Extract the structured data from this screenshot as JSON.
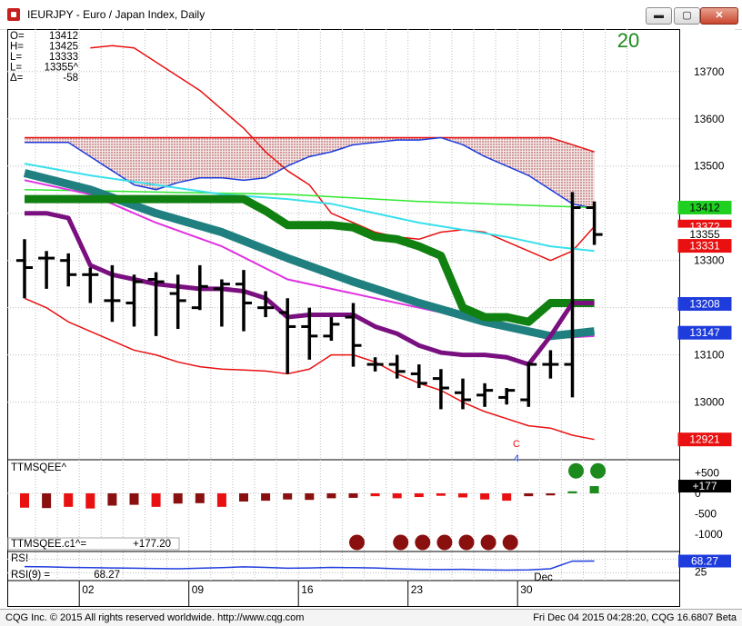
{
  "window": {
    "title": "IEURJPY - Euro / Japan Index, Daily",
    "minimize": "▬",
    "maximize": "▢",
    "close": "✕"
  },
  "ohlc": {
    "rows": [
      {
        "k": "O=",
        "v": "13412"
      },
      {
        "k": "H=",
        "v": "13425"
      },
      {
        "k": "L=",
        "v": "13333"
      },
      {
        "k": "L=",
        "v": "13355^"
      },
      {
        "k": "Δ=",
        "v": "-58"
      }
    ]
  },
  "bar_count": "20",
  "price_marker": "C",
  "count_marker": "4",
  "indicator": {
    "name": "TTMSQEE^",
    "value_label": "TTMSQEE.c1^=",
    "value": "+177.20",
    "axis": [
      "+500",
      "0",
      "-500",
      "-1000"
    ],
    "badge": "+177"
  },
  "rsi": {
    "name": "RSI",
    "label": "RSI(9) =",
    "value": "68.27",
    "badge": "68.27",
    "axis": [
      "75",
      "25"
    ]
  },
  "footer": {
    "left": "CQG Inc. © 2015 All rights reserved worldwide. http://www.cqg.com",
    "right": "Fri Dec 04 2015 04:28:20, CQG 16.6807 Beta"
  },
  "colors": {
    "bars": "#000000",
    "bollinger": "#e81010",
    "cloud_top": "#e81010",
    "cloud_bottom": "#1e3cdc",
    "green_line": "#2ee82e",
    "cyan_line": "#38e0ec",
    "magenta_line": "#e030e0",
    "purple_line": "#7a1080",
    "teal_line": "#208080",
    "dark_green_line": "#108010",
    "rsi_line": "#1e3cdc",
    "squeeze_green": "#1c8a1c",
    "squeeze_dot_red": "#8a1010"
  },
  "chart_data": {
    "type": "candlestick",
    "title": "IEURJPY - Euro / Japan Index, Daily",
    "ylim": [
      12880,
      13790
    ],
    "y_ticks": [
      13000,
      13100,
      13300,
      13500,
      13600,
      13700
    ],
    "x_ticks": [
      {
        "label": "02",
        "index": 2
      },
      {
        "label": "09",
        "index": 7
      },
      {
        "label": "16",
        "index": 12
      },
      {
        "label": "23",
        "index": 17
      },
      {
        "label": "30",
        "index": 22
      },
      {
        "label": "Dec",
        "index": 23
      }
    ],
    "price_badges": [
      {
        "value": "13412",
        "y": 13412,
        "bg": "#20d020",
        "fg": "#000000"
      },
      {
        "value": "13372",
        "y": 13372,
        "bg": "#e81010",
        "fg": "#ffffff"
      },
      {
        "value": "13355",
        "y": 13355,
        "bg": "#ffffff",
        "fg": "#000000"
      },
      {
        "value": "13331",
        "y": 13331,
        "bg": "#e81010",
        "fg": "#ffffff"
      },
      {
        "value": "13208",
        "y": 13208,
        "bg": "#1e3cdc",
        "fg": "#ffffff"
      },
      {
        "value": "13147",
        "y": 13147,
        "bg": "#1e3cdc",
        "fg": "#ffffff"
      },
      {
        "value": "12921",
        "y": 12921,
        "bg": "#e81010",
        "fg": "#ffffff"
      }
    ],
    "bars": [
      {
        "o": 13300,
        "h": 13345,
        "l": 13220,
        "c": 13285
      },
      {
        "o": 13305,
        "h": 13320,
        "l": 13240,
        "c": 13305
      },
      {
        "o": 13300,
        "h": 13315,
        "l": 13245,
        "c": 13270
      },
      {
        "o": 13270,
        "h": 13285,
        "l": 13210,
        "c": 13270
      },
      {
        "o": 13215,
        "h": 13290,
        "l": 13170,
        "c": 13215
      },
      {
        "o": 13210,
        "h": 13270,
        "l": 13160,
        "c": 13255
      },
      {
        "o": 13260,
        "h": 13275,
        "l": 13140,
        "c": 13255
      },
      {
        "o": 13230,
        "h": 13270,
        "l": 13155,
        "c": 13215
      },
      {
        "o": 13200,
        "h": 13290,
        "l": 13195,
        "c": 13245
      },
      {
        "o": 13240,
        "h": 13260,
        "l": 13160,
        "c": 13250
      },
      {
        "o": 13250,
        "h": 13280,
        "l": 13150,
        "c": 13210
      },
      {
        "o": 13200,
        "h": 13235,
        "l": 13180,
        "c": 13200
      },
      {
        "o": 13190,
        "h": 13220,
        "l": 13060,
        "c": 13160
      },
      {
        "o": 13160,
        "h": 13200,
        "l": 13090,
        "c": 13140
      },
      {
        "o": 13140,
        "h": 13180,
        "l": 13130,
        "c": 13165
      },
      {
        "o": 13180,
        "h": 13210,
        "l": 13075,
        "c": 13120
      },
      {
        "o": 13080,
        "h": 13095,
        "l": 13065,
        "c": 13080
      },
      {
        "o": 13080,
        "h": 13100,
        "l": 13050,
        "c": 13065
      },
      {
        "o": 13060,
        "h": 13080,
        "l": 13030,
        "c": 13040
      },
      {
        "o": 13050,
        "h": 13070,
        "l": 12985,
        "c": 13030
      },
      {
        "o": 13020,
        "h": 13050,
        "l": 12985,
        "c": 13005
      },
      {
        "o": 13015,
        "h": 13040,
        "l": 12990,
        "c": 13025
      },
      {
        "o": 13010,
        "h": 13030,
        "l": 12995,
        "c": 13025
      },
      {
        "o": 13005,
        "h": 13085,
        "l": 12990,
        "c": 13080
      },
      {
        "o": 13080,
        "h": 13110,
        "l": 13050,
        "c": 13080
      },
      {
        "o": 13080,
        "h": 13445,
        "l": 13010,
        "c": 13412
      },
      {
        "o": 13412,
        "h": 13425,
        "l": 13333,
        "c": 13355
      }
    ],
    "series": [
      {
        "name": "bollinger-upper",
        "color": "#e81010",
        "width": 1.5,
        "points": [
          [
            3,
            13750
          ],
          [
            4,
            13755
          ],
          [
            5,
            13750
          ],
          [
            6,
            13720
          ],
          [
            7,
            13690
          ],
          [
            8,
            13660
          ],
          [
            9,
            13620
          ],
          [
            10,
            13580
          ],
          [
            11,
            13530
          ],
          [
            12,
            13490
          ],
          [
            13,
            13460
          ],
          [
            14,
            13400
          ],
          [
            15,
            13380
          ],
          [
            16,
            13360
          ],
          [
            17,
            13350
          ],
          [
            18,
            13345
          ],
          [
            19,
            13360
          ],
          [
            20,
            13365
          ],
          [
            21,
            13360
          ],
          [
            22,
            13340
          ],
          [
            23,
            13320
          ],
          [
            24,
            13300
          ],
          [
            25,
            13320
          ],
          [
            26,
            13372
          ]
        ]
      },
      {
        "name": "bollinger-lower",
        "color": "#e81010",
        "width": 1.5,
        "points": [
          [
            0,
            13220
          ],
          [
            1,
            13200
          ],
          [
            2,
            13170
          ],
          [
            3,
            13150
          ],
          [
            4,
            13130
          ],
          [
            5,
            13110
          ],
          [
            6,
            13100
          ],
          [
            7,
            13085
          ],
          [
            8,
            13075
          ],
          [
            9,
            13070
          ],
          [
            10,
            13068
          ],
          [
            11,
            13066
          ],
          [
            12,
            13060
          ],
          [
            13,
            13070
          ],
          [
            14,
            13100
          ],
          [
            15,
            13100
          ],
          [
            16,
            13085
          ],
          [
            17,
            13060
          ],
          [
            18,
            13040
          ],
          [
            19,
            13025
          ],
          [
            20,
            13000
          ],
          [
            21,
            12980
          ],
          [
            22,
            12965
          ],
          [
            23,
            12950
          ],
          [
            24,
            12945
          ],
          [
            25,
            12930
          ],
          [
            26,
            12921
          ]
        ]
      },
      {
        "name": "cloud-top",
        "color": "#e81010",
        "width": 1.5,
        "points": [
          [
            0,
            13560
          ],
          [
            5,
            13560
          ],
          [
            10,
            13560
          ],
          [
            15,
            13560
          ],
          [
            20,
            13560
          ],
          [
            24,
            13560
          ],
          [
            25,
            13545
          ],
          [
            26,
            13530
          ]
        ]
      },
      {
        "name": "cloud-bottom",
        "color": "#1e3cdc",
        "width": 1.5,
        "points": [
          [
            0,
            13550
          ],
          [
            2,
            13550
          ],
          [
            3,
            13520
          ],
          [
            4,
            13490
          ],
          [
            5,
            13460
          ],
          [
            6,
            13450
          ],
          [
            7,
            13465
          ],
          [
            8,
            13475
          ],
          [
            9,
            13475
          ],
          [
            10,
            13470
          ],
          [
            11,
            13475
          ],
          [
            12,
            13500
          ],
          [
            13,
            13520
          ],
          [
            14,
            13530
          ],
          [
            15,
            13545
          ],
          [
            16,
            13550
          ],
          [
            17,
            13555
          ],
          [
            18,
            13555
          ],
          [
            19,
            13560
          ],
          [
            20,
            13545
          ],
          [
            21,
            13520
          ],
          [
            22,
            13500
          ],
          [
            23,
            13480
          ],
          [
            24,
            13450
          ],
          [
            25,
            13420
          ],
          [
            26,
            13410
          ]
        ]
      },
      {
        "name": "light-green",
        "color": "#2ee82e",
        "width": 1.5,
        "points": [
          [
            0,
            13450
          ],
          [
            6,
            13445
          ],
          [
            12,
            13440
          ],
          [
            18,
            13425
          ],
          [
            24,
            13415
          ],
          [
            26,
            13412
          ]
        ]
      },
      {
        "name": "cyan",
        "color": "#38e0ec",
        "width": 2,
        "points": [
          [
            0,
            13505
          ],
          [
            3,
            13480
          ],
          [
            6,
            13460
          ],
          [
            9,
            13440
          ],
          [
            12,
            13430
          ],
          [
            14,
            13420
          ],
          [
            16,
            13400
          ],
          [
            18,
            13380
          ],
          [
            20,
            13365
          ],
          [
            22,
            13350
          ],
          [
            24,
            13330
          ],
          [
            26,
            13320
          ]
        ]
      },
      {
        "name": "magenta",
        "color": "#e030e0",
        "width": 2,
        "points": [
          [
            0,
            13470
          ],
          [
            3,
            13440
          ],
          [
            6,
            13380
          ],
          [
            9,
            13330
          ],
          [
            12,
            13260
          ],
          [
            15,
            13230
          ],
          [
            18,
            13200
          ],
          [
            21,
            13170
          ],
          [
            24,
            13135
          ],
          [
            26,
            13140
          ]
        ]
      },
      {
        "name": "teal-thick",
        "color": "#208080",
        "width": 9,
        "points": [
          [
            0,
            13485
          ],
          [
            3,
            13450
          ],
          [
            6,
            13400
          ],
          [
            9,
            13360
          ],
          [
            12,
            13305
          ],
          [
            15,
            13255
          ],
          [
            18,
            13210
          ],
          [
            21,
            13170
          ],
          [
            24,
            13140
          ],
          [
            26,
            13150
          ]
        ]
      },
      {
        "name": "dark-green-thick",
        "color": "#108010",
        "width": 9,
        "points": [
          [
            0,
            13430
          ],
          [
            3,
            13430
          ],
          [
            6,
            13430
          ],
          [
            10,
            13430
          ],
          [
            11,
            13405
          ],
          [
            12,
            13375
          ],
          [
            13,
            13375
          ],
          [
            14,
            13375
          ],
          [
            15,
            13370
          ],
          [
            16,
            13350
          ],
          [
            17,
            13345
          ],
          [
            18,
            13330
          ],
          [
            19,
            13310
          ],
          [
            20,
            13200
          ],
          [
            21,
            13180
          ],
          [
            22,
            13180
          ],
          [
            23,
            13170
          ],
          [
            24,
            13210
          ],
          [
            25,
            13210
          ],
          [
            26,
            13210
          ]
        ]
      },
      {
        "name": "purple-thick",
        "color": "#7a1080",
        "width": 5,
        "points": [
          [
            0,
            13400
          ],
          [
            1,
            13400
          ],
          [
            2,
            13390
          ],
          [
            3,
            13290
          ],
          [
            4,
            13270
          ],
          [
            5,
            13260
          ],
          [
            6,
            13250
          ],
          [
            7,
            13245
          ],
          [
            8,
            13240
          ],
          [
            9,
            13240
          ],
          [
            10,
            13235
          ],
          [
            11,
            13220
          ],
          [
            12,
            13180
          ],
          [
            13,
            13185
          ],
          [
            14,
            13185
          ],
          [
            15,
            13185
          ],
          [
            16,
            13160
          ],
          [
            17,
            13145
          ],
          [
            18,
            13120
          ],
          [
            19,
            13105
          ],
          [
            20,
            13100
          ],
          [
            21,
            13100
          ],
          [
            22,
            13095
          ],
          [
            23,
            13080
          ],
          [
            24,
            13140
          ],
          [
            25,
            13210
          ],
          [
            26,
            13210
          ]
        ]
      }
    ],
    "squeeze": {
      "ylim": [
        -1400,
        800
      ],
      "histogram": [
        -350,
        -360,
        -330,
        -370,
        -300,
        -280,
        -330,
        -250,
        -240,
        -330,
        -200,
        -180,
        -150,
        -160,
        -120,
        -110,
        -70,
        -120,
        -90,
        -60,
        -100,
        -150,
        -180,
        -70,
        -50,
        50,
        177
      ],
      "histogram_colors": [
        "#e81010",
        "#8a1010",
        "#e81010",
        "#e81010",
        "#8a1010",
        "#8a1010",
        "#e81010",
        "#8a1010",
        "#8a1010",
        "#e81010",
        "#8a1010",
        "#8a1010",
        "#8a1010",
        "#8a1010",
        "#8a1010",
        "#8a1010",
        "#e81010",
        "#e81010",
        "#e81010",
        "#e81010",
        "#e81010",
        "#e81010",
        "#e81010",
        "#8a1010",
        "#8a1010",
        "#1c8a1c",
        "#1c8a1c"
      ],
      "red_dots_at": [
        15,
        17,
        18,
        19,
        20,
        21,
        22
      ],
      "green_dots_at": [
        25,
        26
      ]
    },
    "rsi_values": [
      48,
      47,
      45,
      44,
      43,
      42,
      41,
      40,
      42,
      44,
      47,
      45,
      42,
      43,
      45,
      44,
      43,
      40,
      38,
      37,
      38,
      36,
      35,
      36,
      40,
      68,
      68.27
    ],
    "rsi_ylim": [
      0,
      100
    ]
  }
}
